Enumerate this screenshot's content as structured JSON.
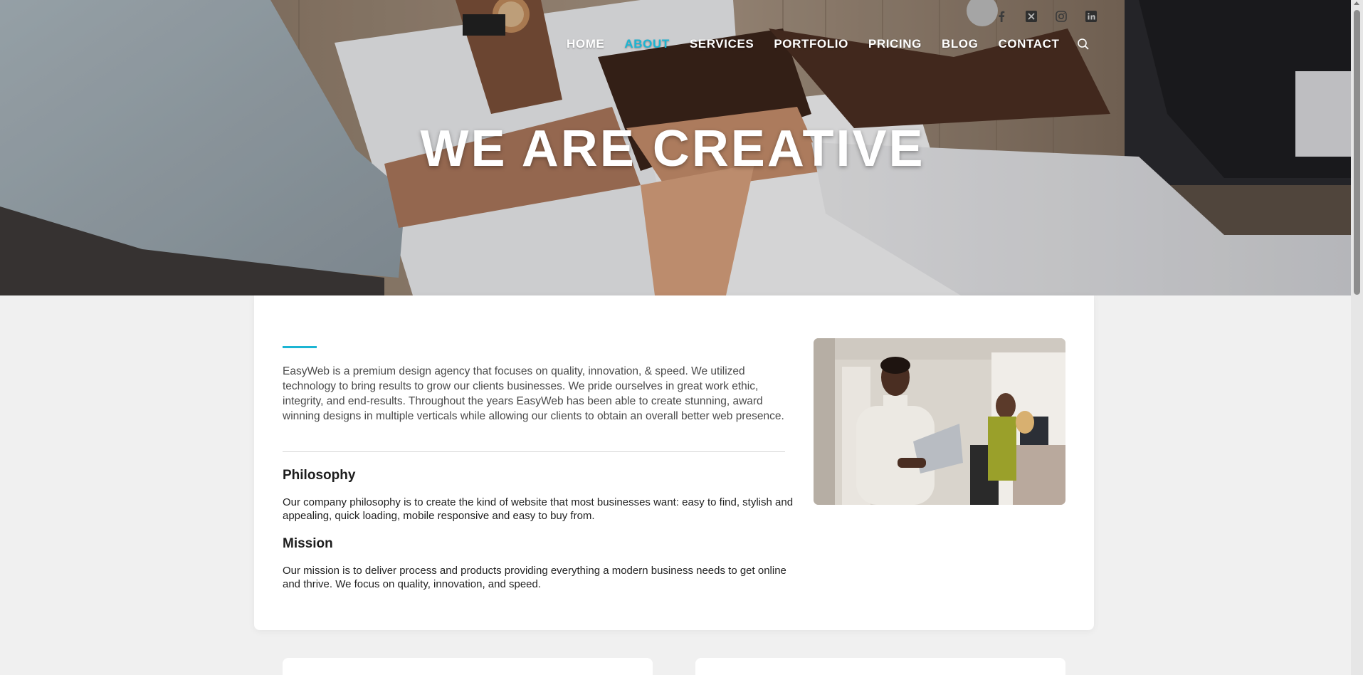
{
  "header": {
    "social": [
      {
        "name": "facebook-icon",
        "glyph": "f"
      },
      {
        "name": "x-icon",
        "glyph": "X"
      },
      {
        "name": "instagram-icon",
        "glyph": "ig"
      },
      {
        "name": "linkedin-icon",
        "glyph": "in"
      }
    ],
    "nav": {
      "items": [
        "HOME",
        "ABOUT",
        "SERVICES",
        "PORTFOLIO",
        "PRICING",
        "BLOG",
        "CONTACT"
      ],
      "active_index": 1,
      "search_icon": "search-icon"
    }
  },
  "hero": {
    "title": "WE ARE CREATIVE"
  },
  "about": {
    "intro": "EasyWeb is a premium design agency that focuses on quality, innovation, & speed. We utilized technology to bring results to grow our clients businesses. We pride ourselves in great work ethic, integrity, and end-results. Throughout the years EasyWeb has been able to create stunning, award winning designs in multiple verticals while allowing our clients to obtain an overall better web presence.",
    "philosophy_heading": "Philosophy",
    "philosophy_text": "Our company philosophy is to create the kind of website that most businesses want: easy to find, stylish and appealing, quick loading, mobile responsive and easy to buy from.",
    "mission_heading": "Mission",
    "mission_text": "Our mission is to deliver process and products providing everything a modern business needs to get online and thrive. We focus on quality, innovation, and speed."
  },
  "colors": {
    "accent": "#1cb5d3",
    "page_bg": "#f0f0f0",
    "card_bg": "#ffffff",
    "nav_text": "#ffffff"
  }
}
